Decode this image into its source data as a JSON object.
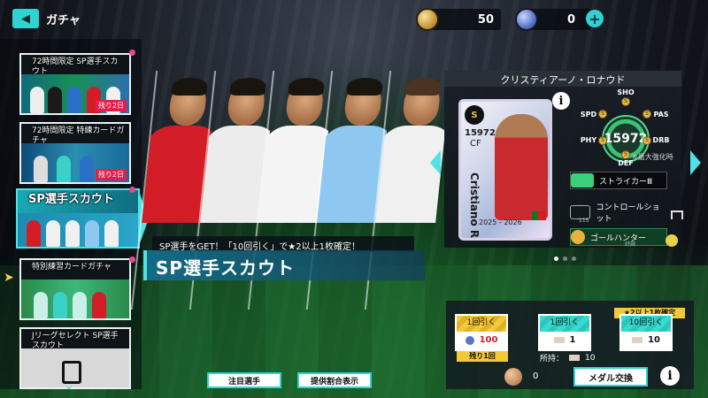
{
  "header": {
    "title": "ガチャ",
    "back_icon": "back-arrow-icon"
  },
  "currency": {
    "gold": {
      "amount": "50",
      "icon": "gold-coin-icon"
    },
    "blue": {
      "amount": "0",
      "icon": "blue-coin-icon",
      "plus": "+"
    }
  },
  "menu": {
    "items": [
      {
        "label": "72時間限定 SP選手スカウト",
        "tag": "残り2日"
      },
      {
        "label": "72時間限定 特練カードガチャ",
        "tag": "残り2日"
      },
      {
        "label": "SP選手スカウト"
      },
      {
        "label": "特別練習カードガチャ"
      },
      {
        "label": "Jリーグセレクト SP選手スカウト"
      }
    ],
    "scroll_icon": "⌄"
  },
  "banner": {
    "tagline": "SP選手をGET！「10回引く」で★2以上1枚確定！",
    "title": "SP選手スカウト"
  },
  "player": {
    "name": "クリスティアーノ・ロナウド",
    "card_name": "Cristiano Ronaldo",
    "rating": "15972",
    "card_rating": "15972",
    "position": "CF",
    "season": "2025 - 2026",
    "badge": "S",
    "stats": {
      "sho": "SHO",
      "spd": "SPD",
      "pas": "PAS",
      "phy": "PHY",
      "drb": "DRB",
      "def": "DEF",
      "grade": "S"
    },
    "max_note": "※最大強化時",
    "skills": [
      {
        "name": "ストライカーⅢ"
      },
      {
        "name": "コントロールショット",
        "sub": "115"
      },
      {
        "name": "ゴールハンター",
        "sub": "好調"
      }
    ],
    "info": "i"
  },
  "pager": {
    "count": 3,
    "active": 0
  },
  "pulls": {
    "single_gold": {
      "label": "1回引く",
      "cost": "100",
      "remaining": "残り1回"
    },
    "single": {
      "label": "1回引く",
      "cost": "1"
    },
    "ten": {
      "label": "10回引く",
      "cost": "10",
      "guarantee": "★2以上1枚確定"
    },
    "owned_label": "所持：",
    "owned_count": "10"
  },
  "medal": {
    "count": "0",
    "button": "メダル交換",
    "info": "i"
  },
  "bottom": {
    "featured": "注目選手",
    "rates": "提供割合表示"
  },
  "colors": {
    "accent": "#2fd3d3",
    "gold": "#f3c93a",
    "pink": "#e74b8f"
  }
}
